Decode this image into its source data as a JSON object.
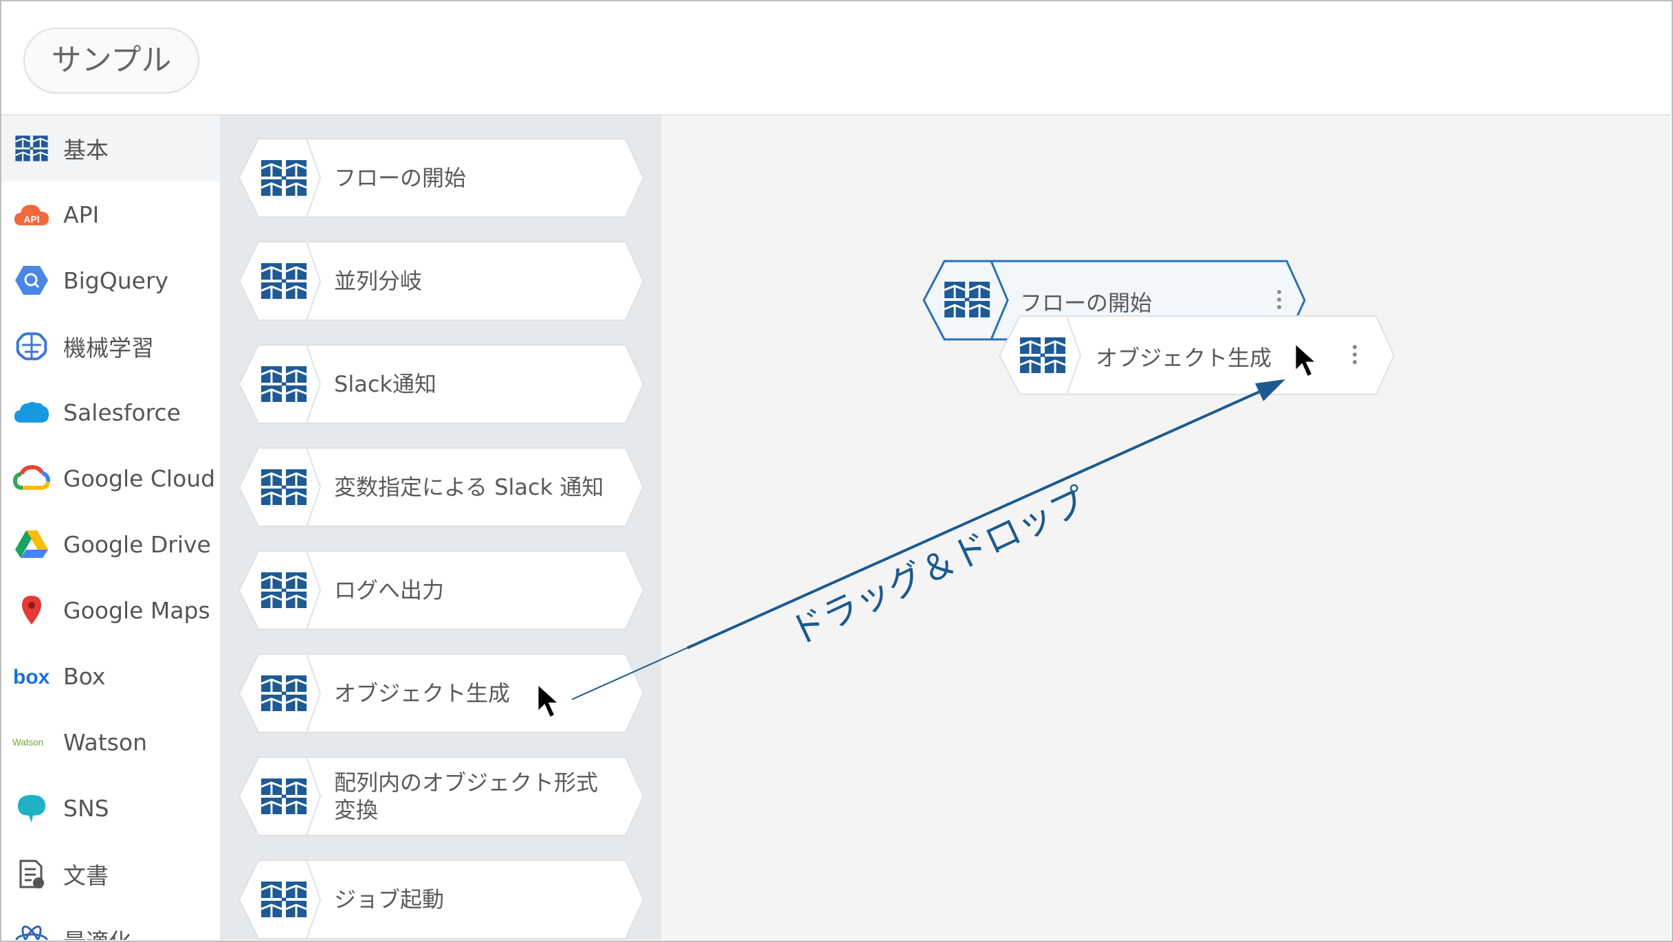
{
  "header": {
    "title": "サンプル"
  },
  "sidebar": {
    "categories": [
      {
        "label": "基本",
        "icon": "cube-icon"
      },
      {
        "label": "API",
        "icon": "api-cloud-icon"
      },
      {
        "label": "BigQuery",
        "icon": "bigquery-icon"
      },
      {
        "label": "機械学習",
        "icon": "brain-icon"
      },
      {
        "label": "Salesforce",
        "icon": "salesforce-cloud-icon"
      },
      {
        "label": "Google Cloud",
        "icon": "google-cloud-icon"
      },
      {
        "label": "Google Drive",
        "icon": "google-drive-icon"
      },
      {
        "label": "Google Maps",
        "icon": "map-pin-icon"
      },
      {
        "label": "Box",
        "icon": "box-logo-icon"
      },
      {
        "label": "Watson",
        "icon": "watson-logo-icon"
      },
      {
        "label": "SNS",
        "icon": "speech-bubble-icon"
      },
      {
        "label": "文書",
        "icon": "document-icon"
      },
      {
        "label": "最適化",
        "icon": "atom-icon"
      }
    ],
    "active_index": 0
  },
  "palette": {
    "nodes": [
      {
        "label": "フローの開始"
      },
      {
        "label": "並列分岐"
      },
      {
        "label": "Slack通知"
      },
      {
        "label": "変数指定による Slack 通知"
      },
      {
        "label": "ログへ出力"
      },
      {
        "label": "オブジェクト生成"
      },
      {
        "label": "配列内のオブジェクト形式変換"
      },
      {
        "label": "ジョブ起動"
      }
    ]
  },
  "canvas": {
    "start_node": {
      "label": "フローの開始"
    },
    "dragged_node": {
      "label": "オブジェクト生成"
    }
  },
  "annotation": {
    "text": "ドラッグ＆ドロップ"
  },
  "colors": {
    "brand_blue": "#1e5a96",
    "selected_border": "#2a6fb6",
    "annotation": "#1b5a90"
  }
}
